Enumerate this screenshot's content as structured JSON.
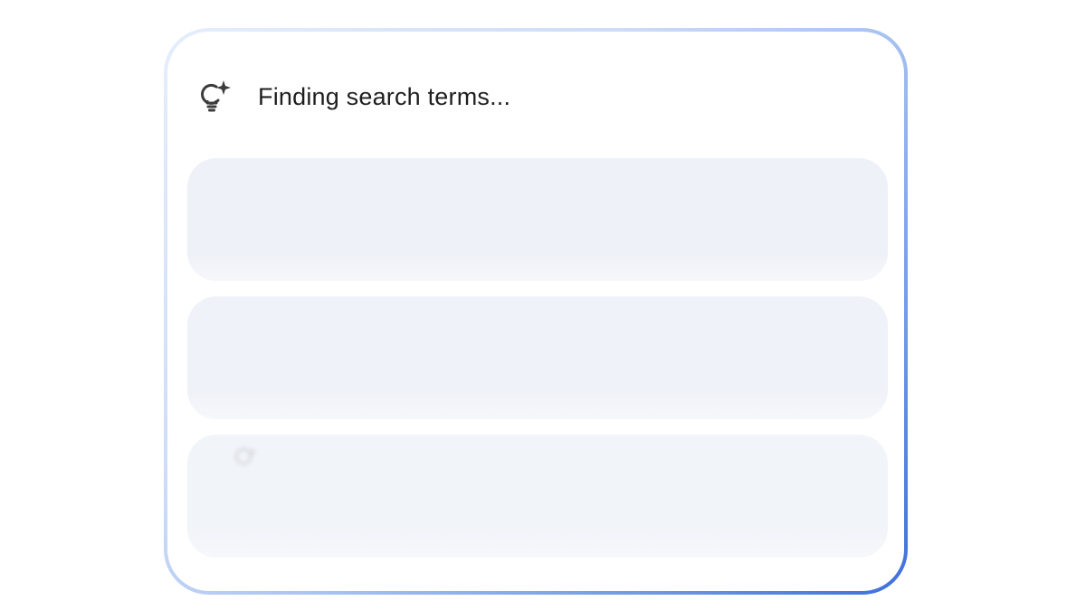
{
  "status": {
    "icon": "lightbulb-sparkle-icon",
    "title": "Finding search terms..."
  },
  "placeholders": [
    {
      "state": "loading"
    },
    {
      "state": "loading"
    },
    {
      "state": "loading"
    }
  ],
  "colors": {
    "border_start": "#e6eefc",
    "border_end": "#3d6fdc",
    "skeleton": "#eef1f7",
    "text": "#1f1f1f"
  }
}
